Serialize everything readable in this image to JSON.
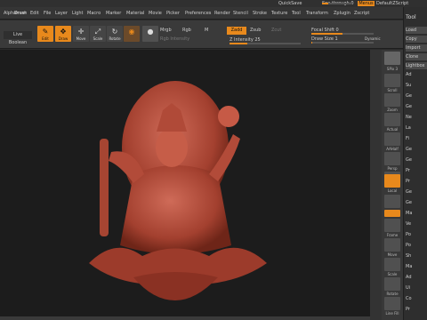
{
  "titlebar": {
    "quicksave": "QuickSave",
    "see_through": "See-through 0",
    "menus": "Menus",
    "script": "DefaultZScript"
  },
  "menu": [
    "Alpha",
    "Brush",
    "Draw",
    "Edit",
    "File",
    "Layer",
    "Light",
    "Macro",
    "Marker",
    "Material",
    "Movie",
    "Picker",
    "Preferences",
    "Render",
    "Stencil",
    "Stroke",
    "Texture",
    "Tool",
    "Transform",
    "Zplugin",
    "Zscript"
  ],
  "shelf": {
    "live_boolean": "Live Boolean",
    "edit": "Edit",
    "draw": "Draw",
    "move": "Move",
    "scale": "Scale",
    "rotate": "Rotate",
    "mrgb": "Mrgb",
    "rgb": "Rgb",
    "m": "M",
    "rgb_intensity": "Rgb Intensity",
    "zadd": "Zadd",
    "zsub": "Zsub",
    "zcut": "Zcut",
    "z_intensity": "Z Intensity 25",
    "focal_shift": "Focal Shift 0",
    "draw_size": "Draw Size 1",
    "dynamic": "Dynamic",
    "z_intensity_fill": 0.25
  },
  "right_tools": [
    "SPix 3",
    "Scroll",
    "Zoom",
    "Actual",
    "AAHalf",
    "Persp",
    "Floor",
    "Local",
    "L.Sym",
    "Frame",
    "Move",
    "Scale",
    "Rotate",
    "Line Fill"
  ],
  "panel": {
    "title": "Tool",
    "items": [
      "Load",
      "Copy",
      "Import",
      "Clone",
      "Lightbox",
      "Ad",
      "Su",
      "Ge",
      "Ge",
      "Ne",
      "La",
      "Fi",
      "Ge",
      "Ge",
      "Pr",
      "Pr",
      "Ge",
      "Ge",
      "Ma",
      "Ve",
      "Po",
      "Po",
      "Sh",
      "Ma",
      "Ad",
      "Ui",
      "Co",
      "Pr"
    ]
  },
  "colors": {
    "accent": "#e8891c",
    "model": "#b0473a"
  }
}
